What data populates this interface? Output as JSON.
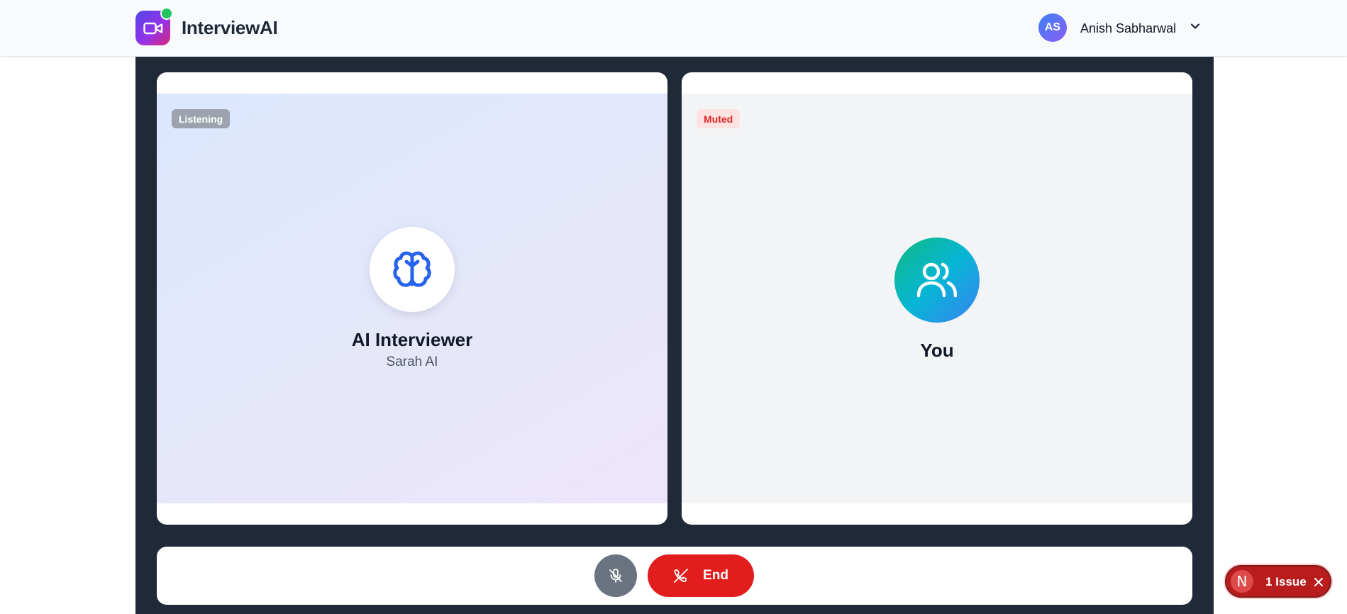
{
  "header": {
    "brand": "InterviewAI",
    "user": {
      "initials": "AS",
      "name": "Anish Sabharwal"
    }
  },
  "ai_panel": {
    "status_badge": "Listening",
    "title": "AI Interviewer",
    "subtitle": "Sarah AI",
    "icon": "brain-icon"
  },
  "user_panel": {
    "status_badge": "Muted",
    "title": "You",
    "icon": "users-icon"
  },
  "controls": {
    "mic_icon": "mic-off-icon",
    "end_label": "End",
    "end_icon": "phone-off-icon"
  },
  "dev_overlay": {
    "logo_letter": "N",
    "issues_label": "1 Issue"
  },
  "colors": {
    "accent_blue": "#2563eb",
    "end_red": "#e11d1d",
    "stage_bg": "#1f2937",
    "online_green": "#22c55e"
  }
}
